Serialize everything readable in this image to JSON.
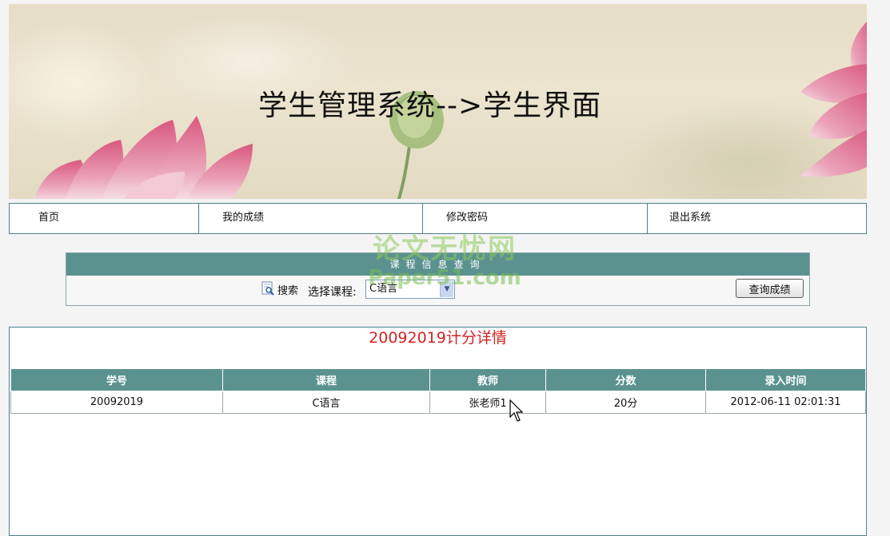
{
  "banner": {
    "title": "学生管理系统-->学生界面"
  },
  "nav": {
    "items": [
      {
        "label": "首页"
      },
      {
        "label": "我的成绩"
      },
      {
        "label": "修改密码"
      },
      {
        "label": "退出系统"
      }
    ]
  },
  "query": {
    "title": "课程信息查询",
    "search_label": "搜索",
    "select_label": "选择课程:",
    "course_value": "C语言",
    "button_label": "查询成绩"
  },
  "detail": {
    "title": "20092019计分详情",
    "columns": [
      "学号",
      "课程",
      "教师",
      "分数",
      "录入时间"
    ],
    "rows": [
      [
        "20092019",
        "C语言",
        "张老师1",
        "20分",
        "2012-06-11 02:01:31"
      ]
    ]
  },
  "watermark": {
    "line1": "论文无忧网",
    "line2": "Paper51.com"
  },
  "colors": {
    "header_teal": "#5b9290",
    "border_teal": "#4f7f8a",
    "title_red": "#d22323"
  }
}
